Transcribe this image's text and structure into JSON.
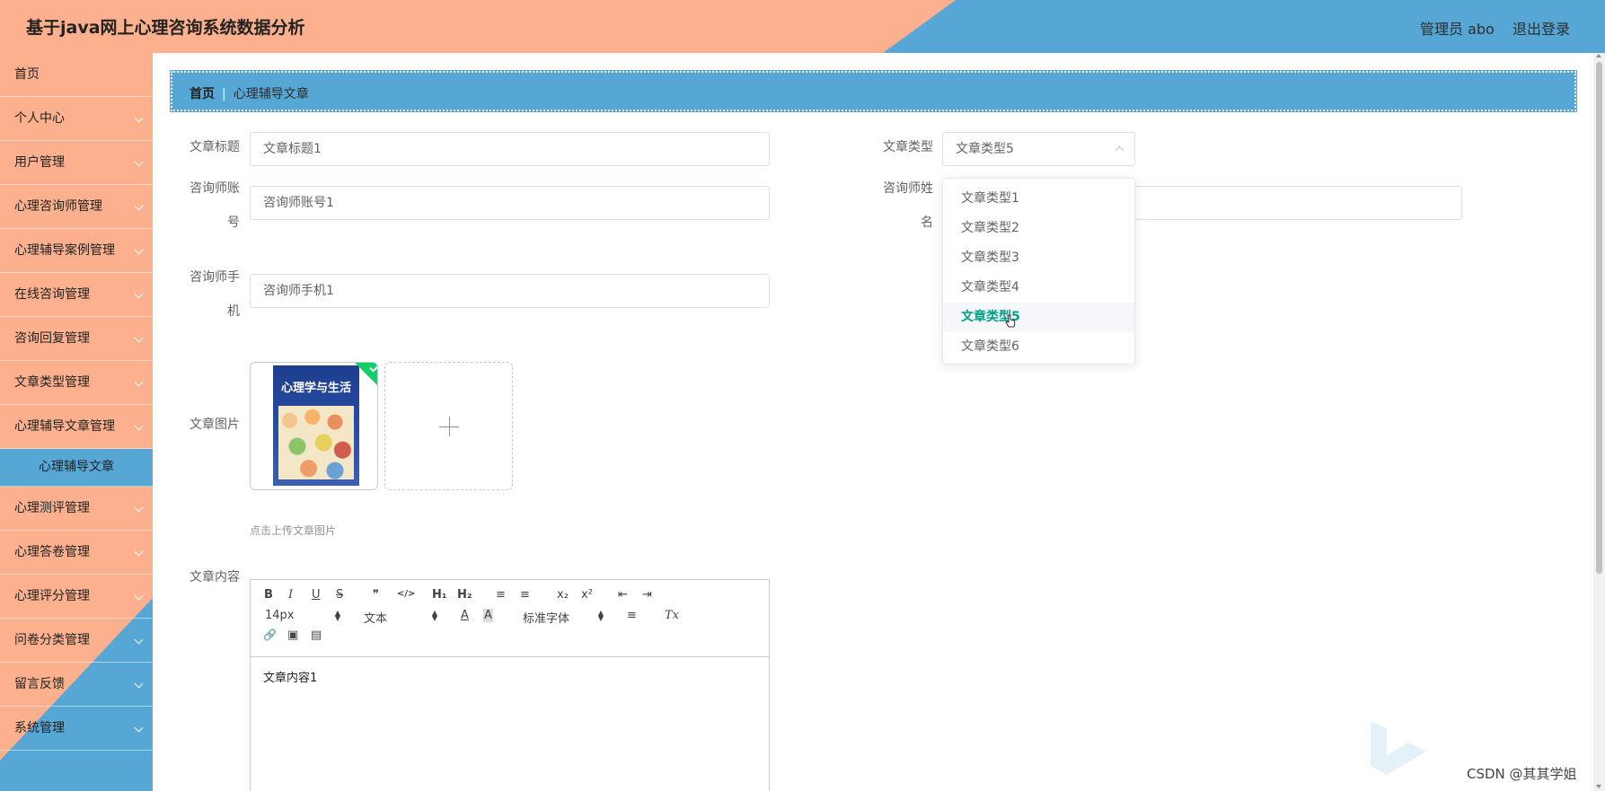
{
  "header": {
    "title": "基于java网上心理咨询系统数据分析",
    "user": "管理员 abo",
    "logout": "退出登录"
  },
  "sidebar": {
    "items": [
      {
        "label": "首页"
      },
      {
        "label": "个人中心"
      },
      {
        "label": "用户管理"
      },
      {
        "label": "心理咨询师管理"
      },
      {
        "label": "心理辅导案例管理"
      },
      {
        "label": "在线咨询管理"
      },
      {
        "label": "咨询回复管理"
      },
      {
        "label": "文章类型管理"
      },
      {
        "label": "心理辅导文章管理"
      },
      {
        "label": "心理辅导文章"
      },
      {
        "label": "心理测评管理"
      },
      {
        "label": "心理答卷管理"
      },
      {
        "label": "心理评分管理"
      },
      {
        "label": "问卷分类管理"
      },
      {
        "label": "留言反馈"
      },
      {
        "label": "系统管理"
      }
    ]
  },
  "breadcrumb": {
    "home": "首页",
    "separator": "|",
    "current": "心理辅导文章"
  },
  "form": {
    "title_label": "文章标题",
    "title_value": "文章标题1",
    "type_label": "文章类型",
    "type_value": "文章类型5",
    "account_label_1": "咨询师账",
    "account_label_2": "号",
    "account_value": "咨询师账号1",
    "name_label_1": "咨询师姓",
    "name_label_2": "名",
    "phone_label_1": "咨询师手",
    "phone_label_2": "机",
    "phone_value": "咨询师手机1",
    "image_label": "文章图片",
    "upload_tip": "点击上传文章图片",
    "content_label": "文章内容",
    "content_value": "文章内容1"
  },
  "book": {
    "title": "心理学与生活"
  },
  "dropdown": {
    "options": [
      "文章类型1",
      "文章类型2",
      "文章类型3",
      "文章类型4",
      "文章类型5",
      "文章类型6"
    ],
    "selected": "文章类型5"
  },
  "editor": {
    "bold": "B",
    "italic": "I",
    "underline": "U",
    "strike": "S",
    "quote": "❞",
    "code": "</>",
    "h1": "H₁",
    "h2": "H₂",
    "ol": "≡",
    "ul": "≡",
    "sub": "x₂",
    "sup": "x²",
    "outdent": "⇤",
    "indent": "⇥",
    "font_size": "14px",
    "header_select": "文本",
    "color": "A",
    "background": "A",
    "font_family": "标准字体",
    "align": "≡",
    "clean": "Tx",
    "link": "🔗",
    "image": "▣",
    "video": "▤"
  },
  "watermark": "CSDN @其其学姐",
  "colors": {
    "salmon": "#fdb08d",
    "blue": "#56a7d5",
    "selected_option": "#00a088"
  }
}
